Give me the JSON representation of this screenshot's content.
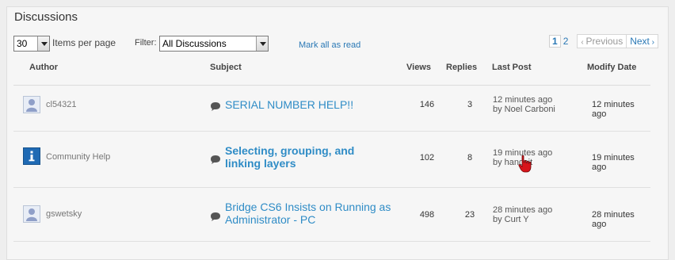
{
  "title": "Discussions",
  "toolbar": {
    "per_page_value": "30",
    "per_page_label": "Items per page",
    "filter_label": "Filter:",
    "filter_value": "All Discussions",
    "mark_all_read": "Mark all as read"
  },
  "pager": {
    "pages": [
      "1",
      "2"
    ],
    "previous": "Previous",
    "next": "Next"
  },
  "columns": {
    "author": "Author",
    "subject": "Subject",
    "views": "Views",
    "replies": "Replies",
    "last_post": "Last Post",
    "modify_date": "Modify Date"
  },
  "rows": [
    {
      "author": "cl54321",
      "avatar": "user-avatar-icon",
      "subject": "SERIAL NUMBER HELP!!",
      "views": "146",
      "replies": "3",
      "last_post_time": "12 minutes ago",
      "last_post_by": "by Noel Carboni",
      "modify_date": "12 minutes ago"
    },
    {
      "author": "Community Help",
      "avatar": "info-avatar-icon",
      "subject_line1": "Selecting, grouping, and",
      "subject_line2": "linking layers",
      "views": "102",
      "replies": "8",
      "last_post_time": "19 minutes ago",
      "last_post_by": "by hangsit",
      "modify_date": "19 minutes ago"
    },
    {
      "author": "gswetsky",
      "avatar": "user-avatar-icon",
      "subject_line1": "Bridge CS6 Insists on Running as",
      "subject_line2": "Administrator - PC",
      "views": "498",
      "replies": "23",
      "last_post_time": "28 minutes ago",
      "last_post_by": "by Curt Y",
      "modify_date": "28 minutes ago"
    }
  ],
  "colors": {
    "link": "#2f8cc6",
    "panel_bg": "#f6f6f6",
    "cursor": "#d7141a"
  }
}
